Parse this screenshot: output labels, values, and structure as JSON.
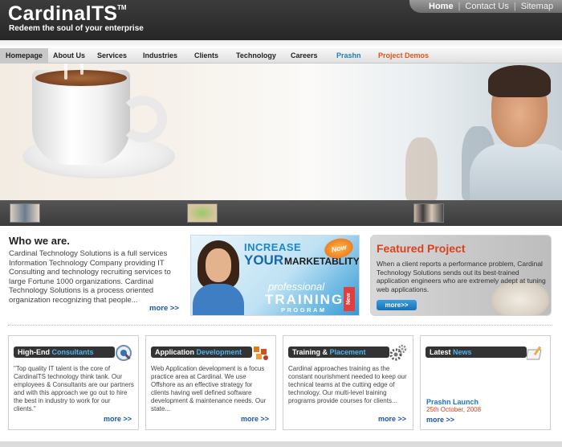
{
  "header": {
    "logo_main": "Cardinal",
    "logo_ts": "TS",
    "logo_tm": "TM",
    "tagline": "Redeem the soul of your enterprise",
    "toplinks": [
      "Home",
      "Contact Us",
      "Sitemap"
    ],
    "separator": "|"
  },
  "nav": {
    "items": [
      "Homepage",
      "About Us",
      "Services",
      "Industries",
      "Clients",
      "Technology",
      "Careers",
      "Prashn",
      "Project Demos"
    ]
  },
  "who": {
    "title": "Who we are.",
    "text": "Cardinal Technology Solutions is a full services Information Technology Company providing IT Consulting and technology recruiting services to large Fortune 1000 organizations. Cardinal Technology Solutions is a process oriented organization recognizing that people...",
    "more": "more >>"
  },
  "banner": {
    "increase": "INCREASE",
    "your": "YOUR",
    "marketability": "MARKETABLITY",
    "now": "Now",
    "professional": "professional",
    "training": "TRAINING",
    "program": "PROGRAM",
    "new": "New"
  },
  "featured": {
    "title": "Featured Project",
    "text": "When a client reports a performance problem, Cardinal Technology Solutions sends out its best-trained application engineers who are extremely adept at tuning web applications.",
    "more": "more>>"
  },
  "boxes": [
    {
      "head_plain": "High-End ",
      "head_hl": "Consultants",
      "text": "\"Top quality IT talent is the core of CardinalTS technology think tank. Our employees & Consultants are our partners and with this approach we go out to hire the best in industry to work for our clients.\"",
      "more": "more >>"
    },
    {
      "head_plain": "Application ",
      "head_hl": "Development",
      "text": "Web Application development is a focus practice area at Cardinal. We use Offshore as an effective strategy for clients having well defined software development & maintenance needs. Our state...",
      "more": "more >>"
    },
    {
      "head_plain": "Training & ",
      "head_hl": "Placement",
      "text": "Cardinal approaches training as the constant nourishment needed to keep our technical teams at the cutting edge of technology. Our multi-level training programs provide courses for clients...",
      "more": "more >>"
    },
    {
      "head_plain": "Latest ",
      "head_hl": "News",
      "news_title": "Prashn Launch",
      "news_date": "25th October, 2008",
      "more": "more >>"
    }
  ],
  "colors": {
    "accent_blue": "#1a55b0",
    "accent_orange": "#d8421d",
    "header_dark": "#2e2e2e"
  }
}
